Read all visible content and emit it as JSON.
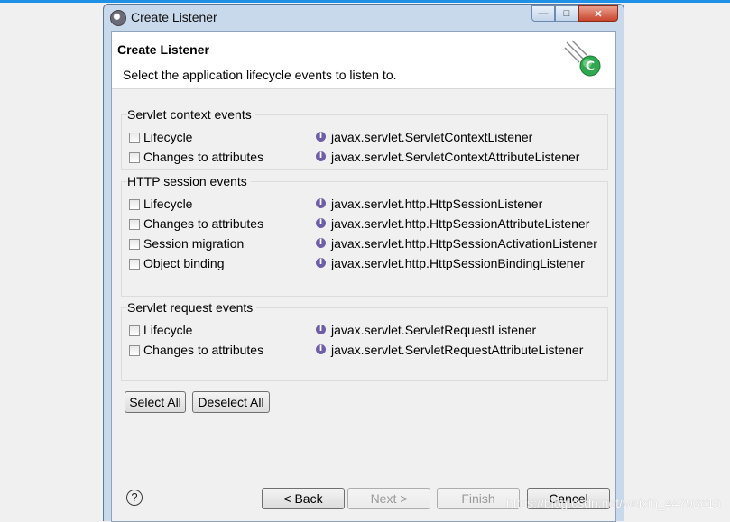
{
  "window": {
    "title": "Create Listener",
    "icon": "eclipse-icon",
    "controls": [
      "minimize",
      "maximize",
      "close"
    ]
  },
  "banner": {
    "title": "Create Listener",
    "description": "Select the application lifecycle events to listen to.",
    "icon": "listener-wizard-icon"
  },
  "groups": [
    {
      "title": "Servlet context events",
      "rows": [
        {
          "label": "Lifecycle",
          "checked": false,
          "interface": "javax.servlet.ServletContextListener"
        },
        {
          "label": "Changes to attributes",
          "checked": false,
          "interface": "javax.servlet.ServletContextAttributeListener"
        }
      ]
    },
    {
      "title": "HTTP session events",
      "rows": [
        {
          "label": "Lifecycle",
          "checked": false,
          "interface": "javax.servlet.http.HttpSessionListener"
        },
        {
          "label": "Changes to attributes",
          "checked": false,
          "interface": "javax.servlet.http.HttpSessionAttributeListener"
        },
        {
          "label": "Session migration",
          "checked": false,
          "interface": "javax.servlet.http.HttpSessionActivationListener"
        },
        {
          "label": "Object binding",
          "checked": false,
          "interface": "javax.servlet.http.HttpSessionBindingListener"
        }
      ]
    },
    {
      "title": "Servlet request events",
      "rows": [
        {
          "label": "Lifecycle",
          "checked": false,
          "interface": "javax.servlet.ServletRequestListener"
        },
        {
          "label": "Changes to attributes",
          "checked": false,
          "interface": "javax.servlet.ServletRequestAttributeListener"
        }
      ]
    }
  ],
  "selection_buttons": {
    "select_all": "Select All",
    "deselect_all": "Deselect All"
  },
  "footer": {
    "help": "?",
    "back": "< Back",
    "next": "Next >",
    "finish": "Finish",
    "cancel": "Cancel"
  },
  "watermark": "https://blog.csdn.net/weixin_44793615",
  "colors": {
    "accent_blue": "#1e90e6",
    "title_bar": "#c9d9ec",
    "close_button": "#c8452c",
    "interface_icon": "#6e5ea8",
    "wizard_badge": "#2fa84f"
  }
}
